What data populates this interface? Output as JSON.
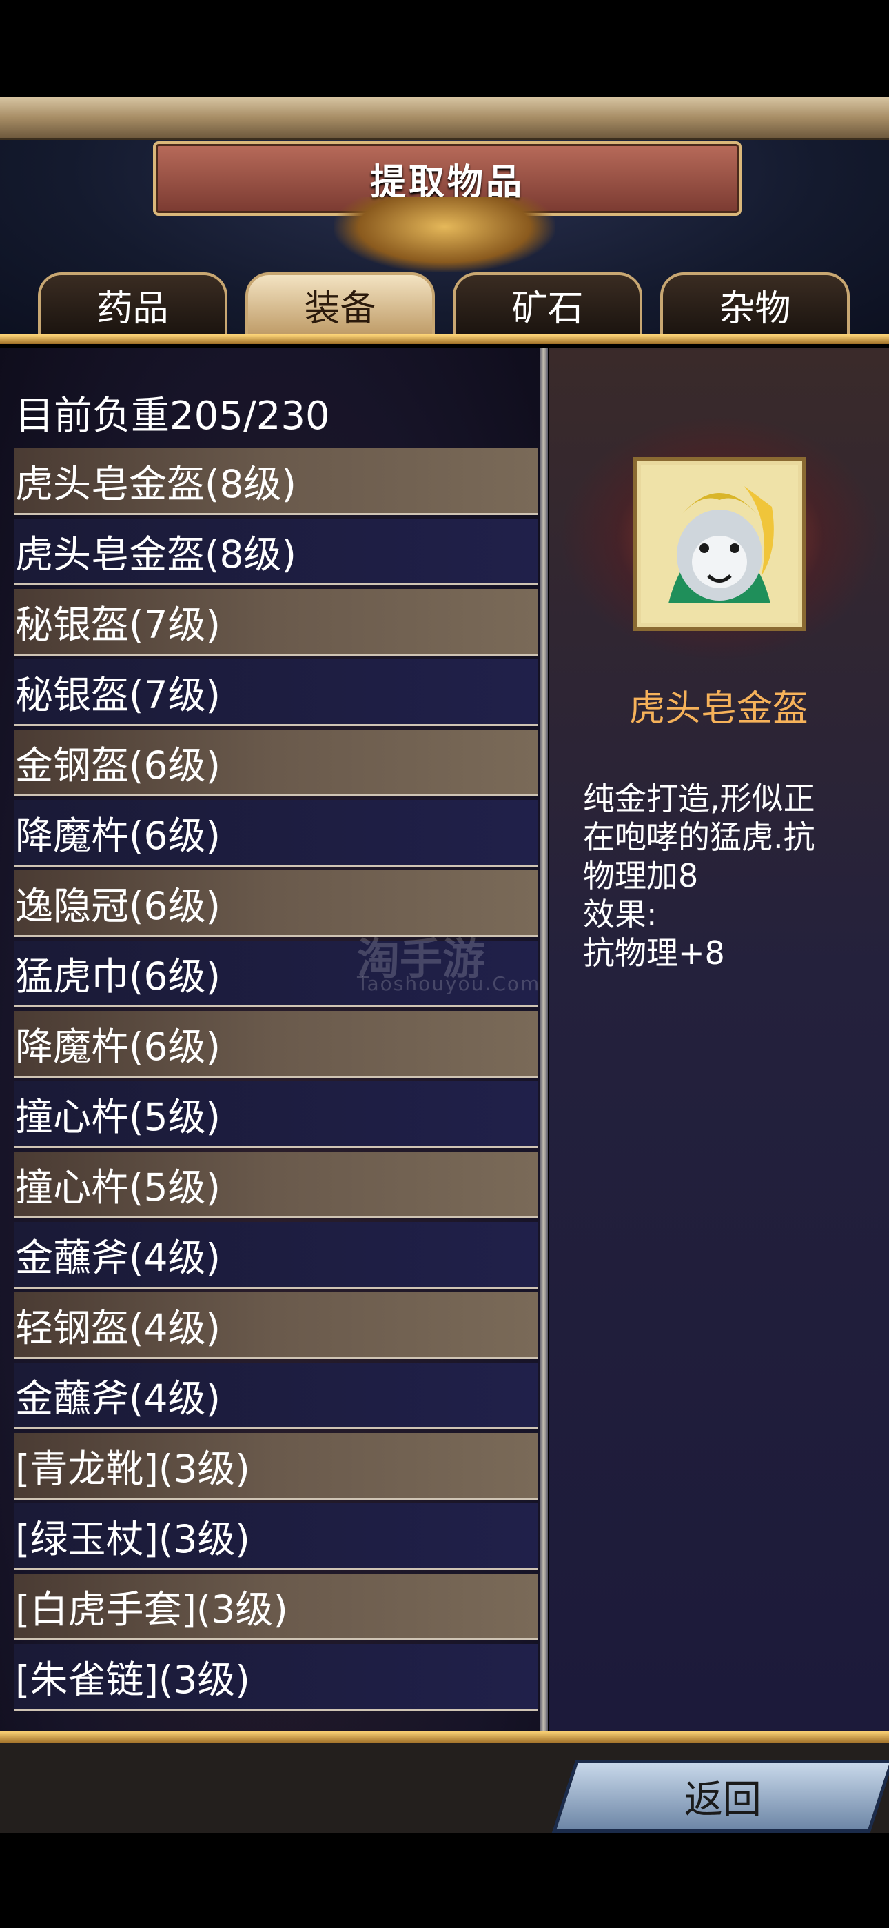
{
  "header": {
    "title": "提取物品"
  },
  "tabs": [
    {
      "label": "药品",
      "active": false
    },
    {
      "label": "装备",
      "active": true
    },
    {
      "label": "矿石",
      "active": false
    },
    {
      "label": "杂物",
      "active": false
    }
  ],
  "inventory": {
    "weight_label": "目前负重205/230",
    "items": [
      "虎头皂金盔(8级)",
      "虎头皂金盔(8级)",
      "秘银盔(7级)",
      "秘银盔(7级)",
      "金钢盔(6级)",
      "降魔杵(6级)",
      "逸隐冠(6级)",
      "猛虎巾(6级)",
      "降魔杵(6级)",
      "撞心杵(5级)",
      "撞心杵(5级)",
      "金蘸斧(4级)",
      "轻钢盔(4级)",
      "金蘸斧(4级)",
      "[青龙靴](3级)",
      "[绿玉杖](3级)",
      "[白虎手套](3级)",
      "[朱雀链](3级)"
    ]
  },
  "detail": {
    "name": "虎头皂金盔",
    "description_lines": [
      "纯金打造,形似正",
      "在咆哮的猛虎.抗",
      "物理加8",
      "效果:",
      "抗物理+8"
    ],
    "icon": "tiger-helmet-icon"
  },
  "watermark": {
    "main": "淘手游",
    "sub": "Taoshouyou.Com"
  },
  "footer": {
    "back_label": "返回"
  }
}
